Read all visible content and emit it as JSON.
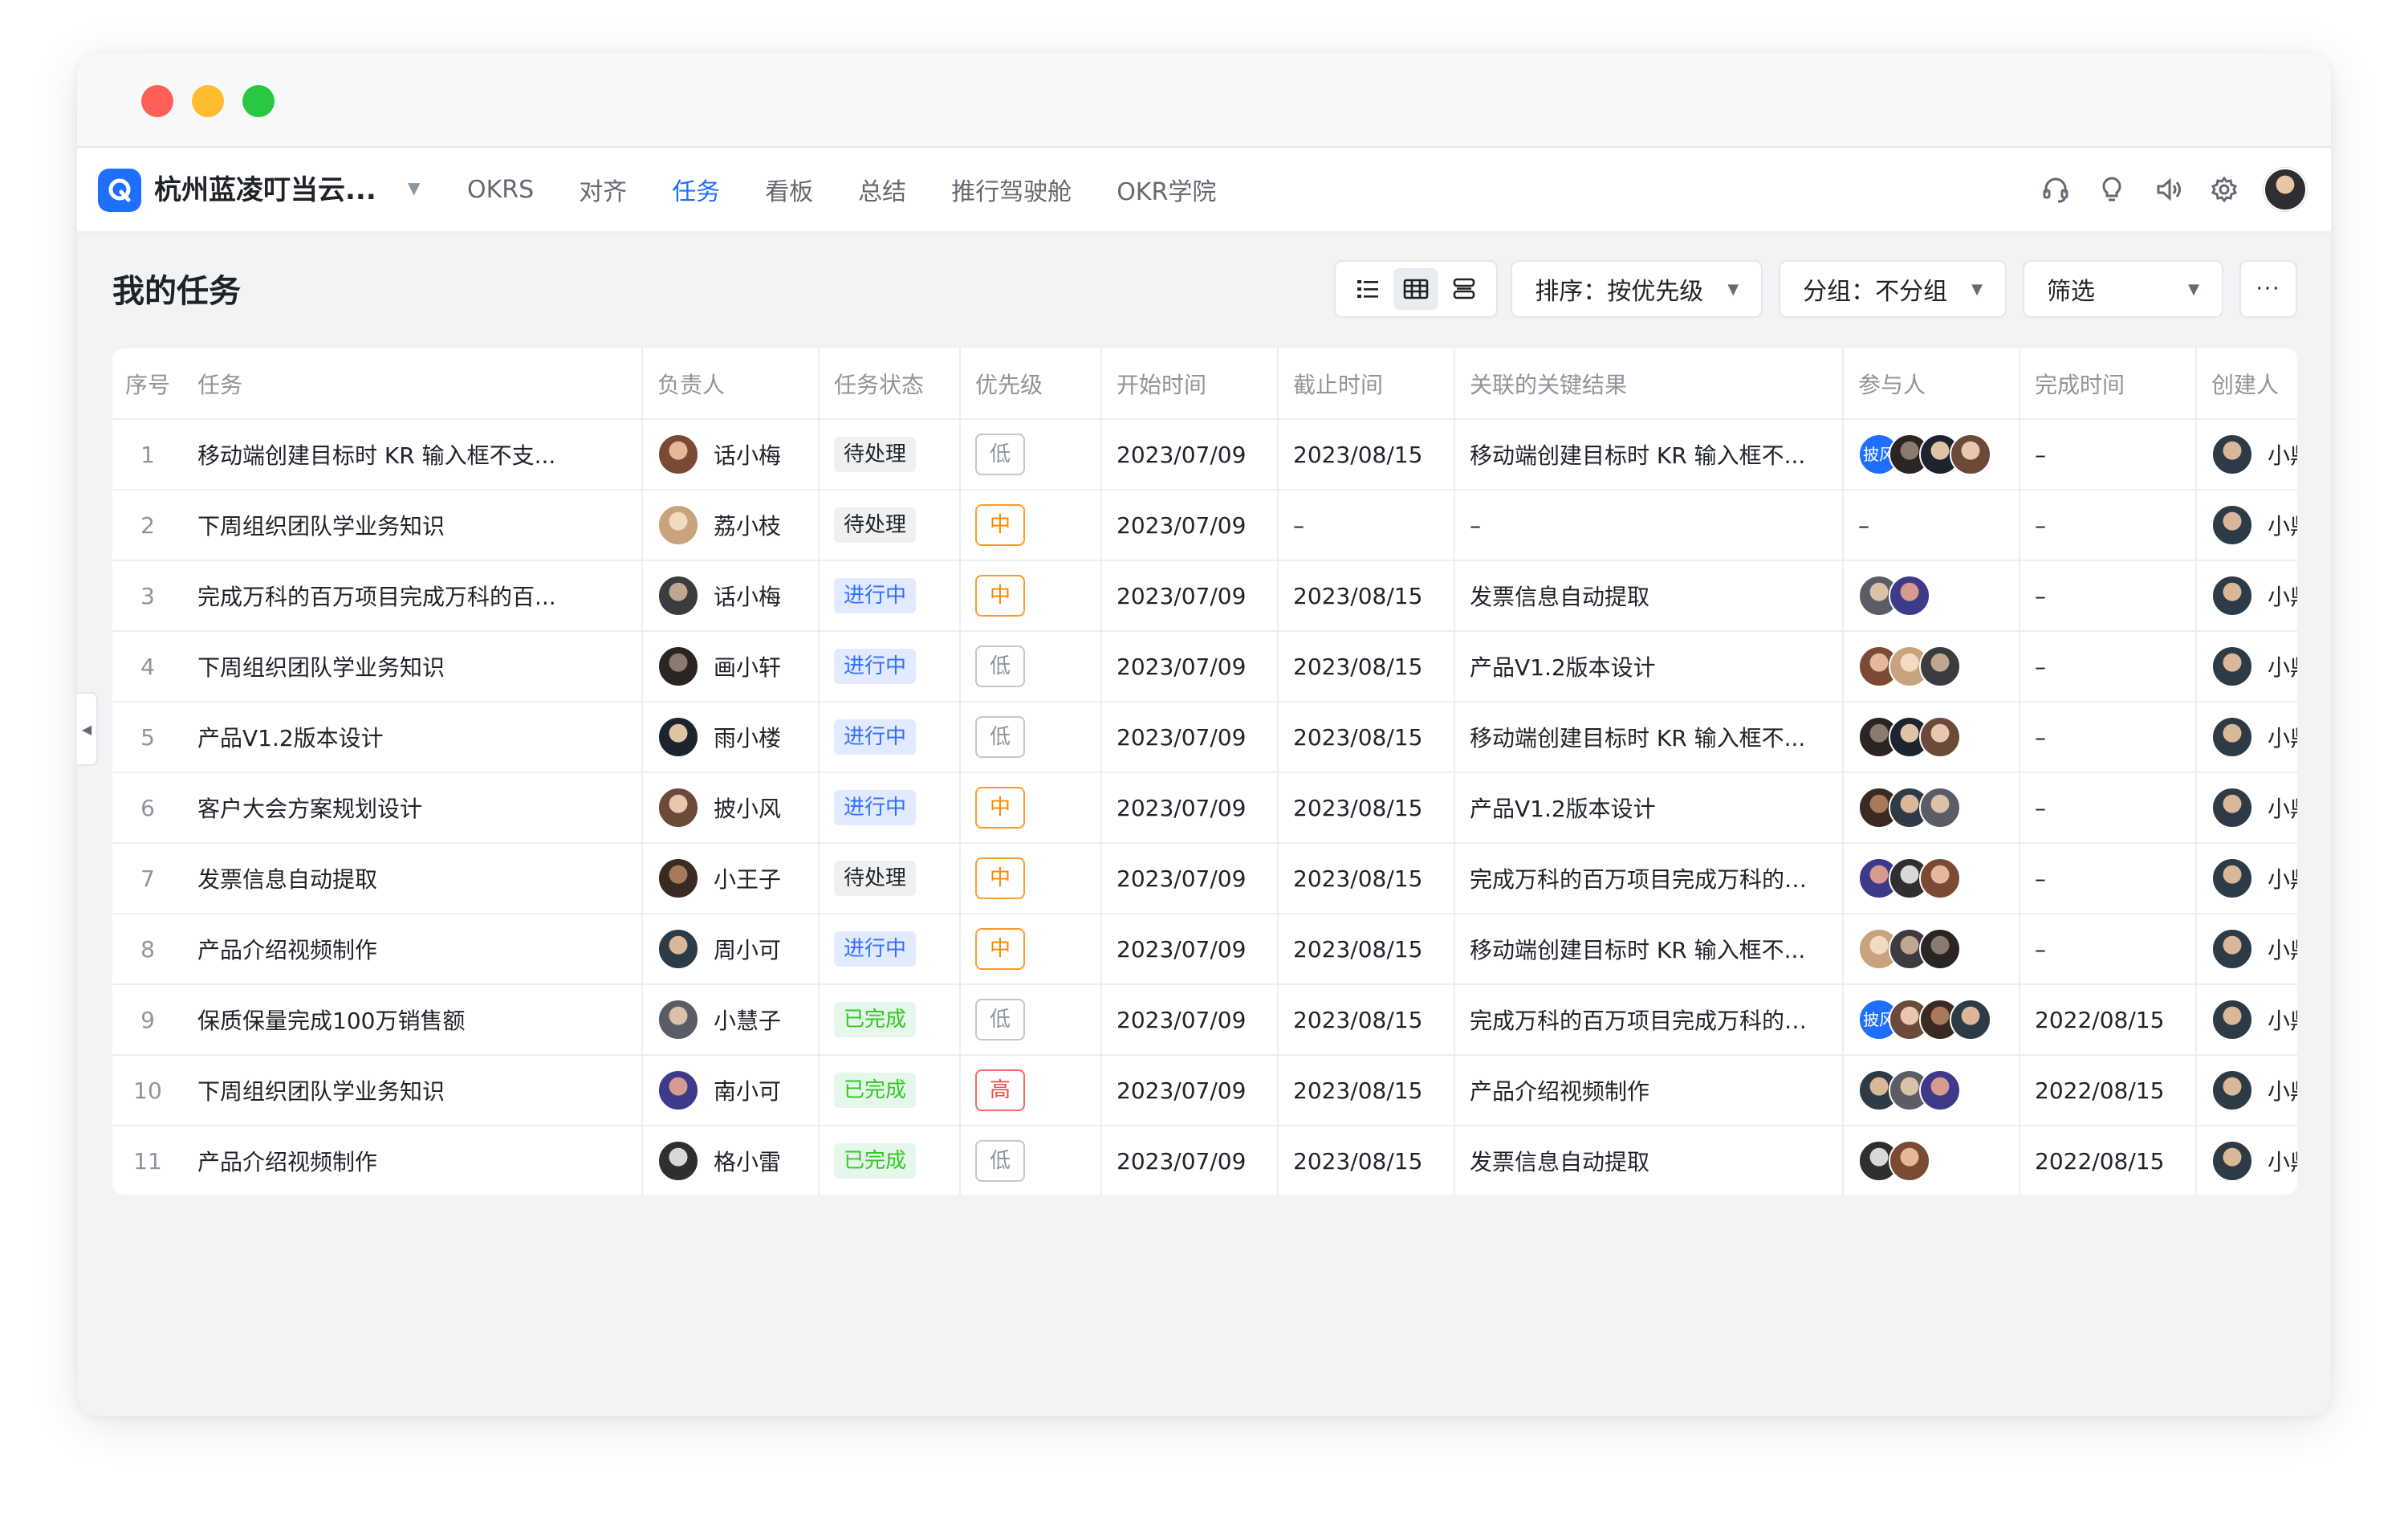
{
  "window": {
    "controls": [
      "close",
      "minimize",
      "maximize"
    ]
  },
  "nav": {
    "company": "杭州蓝凌叮当云...",
    "items": [
      {
        "label": "OKRS",
        "active": false
      },
      {
        "label": "对齐",
        "active": false
      },
      {
        "label": "任务",
        "active": true
      },
      {
        "label": "看板",
        "active": false
      },
      {
        "label": "总结",
        "active": false
      },
      {
        "label": "推行驾驶舱",
        "active": false
      },
      {
        "label": "OKR学院",
        "active": false
      }
    ],
    "icons": [
      "headset-icon",
      "lightbulb-icon",
      "speaker-icon",
      "settings-icon"
    ]
  },
  "page": {
    "title": "我的任务",
    "sort_label": "排序：按优先级",
    "group_label": "分组：不分组",
    "filter_label": "筛选",
    "more_label": "···"
  },
  "colors": {
    "accent": "#1f6fff",
    "in_progress": "#3370ff",
    "done": "#34c724",
    "mid_priority": "#ff8800",
    "high_priority": "#f54a45"
  },
  "table": {
    "headers": [
      "序号",
      "任务",
      "负责人",
      "任务状态",
      "优先级",
      "开始时间",
      "截止时间",
      "关联的关键结果",
      "参与人",
      "完成时间",
      "创建人"
    ],
    "rows": [
      {
        "no": "1",
        "task": "移动端创建目标时 KR 输入框不支...",
        "owner": "话小梅",
        "status": "待处理",
        "priority": "低",
        "start": "2023/07/09",
        "due": "2023/08/15",
        "kr": "移动端创建目标时 KR 输入框不...",
        "participants": [
          "披风",
          "p",
          "p",
          "p"
        ],
        "done": "–",
        "creator": "小鼎"
      },
      {
        "no": "2",
        "task": "下周组织团队学业务知识",
        "owner": "荔小枝",
        "status": "待处理",
        "priority": "中",
        "start": "2023/07/09",
        "due": "–",
        "kr": "–",
        "participants": [],
        "participants_text": "–",
        "done": "–",
        "creator": "小鼎"
      },
      {
        "no": "3",
        "task": "完成万科的百万项目完成万科的百...",
        "owner": "话小梅",
        "status": "进行中",
        "priority": "中",
        "start": "2023/07/09",
        "due": "2023/08/15",
        "kr": "发票信息自动提取",
        "participants": [
          "p",
          "p"
        ],
        "done": "–",
        "creator": "小鼎"
      },
      {
        "no": "4",
        "task": "下周组织团队学业务知识",
        "owner": "画小轩",
        "status": "进行中",
        "priority": "低",
        "start": "2023/07/09",
        "due": "2023/08/15",
        "kr": "产品V1.2版本设计",
        "participants": [
          "p",
          "p",
          "p"
        ],
        "done": "–",
        "creator": "小鼎"
      },
      {
        "no": "5",
        "task": "产品V1.2版本设计",
        "owner": "雨小楼",
        "status": "进行中",
        "priority": "低",
        "start": "2023/07/09",
        "due": "2023/08/15",
        "kr": "移动端创建目标时 KR 输入框不...",
        "participants": [
          "p",
          "p",
          "p"
        ],
        "done": "–",
        "creator": "小鼎"
      },
      {
        "no": "6",
        "task": "客户大会方案规划设计",
        "owner": "披小风",
        "status": "进行中",
        "priority": "中",
        "start": "2023/07/09",
        "due": "2023/08/15",
        "kr": "产品V1.2版本设计",
        "participants": [
          "p",
          "p",
          "p"
        ],
        "done": "–",
        "creator": "小鼎"
      },
      {
        "no": "7",
        "task": "发票信息自动提取",
        "owner": "小王子",
        "status": "待处理",
        "priority": "中",
        "start": "2023/07/09",
        "due": "2023/08/15",
        "kr": "完成万科的百万项目完成万科的百...",
        "participants": [
          "p",
          "p",
          "p"
        ],
        "done": "–",
        "creator": "小鼎"
      },
      {
        "no": "8",
        "task": "产品介绍视频制作",
        "owner": "周小可",
        "status": "进行中",
        "priority": "中",
        "start": "2023/07/09",
        "due": "2023/08/15",
        "kr": "移动端创建目标时 KR 输入框不...",
        "participants": [
          "p",
          "p",
          "p"
        ],
        "done": "–",
        "creator": "小鼎"
      },
      {
        "no": "9",
        "task": "保质保量完成100万销售额",
        "owner": "小慧子",
        "status": "已完成",
        "priority": "低",
        "start": "2023/07/09",
        "due": "2023/08/15",
        "kr": "完成万科的百万项目完成万科的百...",
        "participants": [
          "披风",
          "p",
          "p",
          "p"
        ],
        "done": "2022/08/15",
        "creator": "小鼎"
      },
      {
        "no": "10",
        "task": "下周组织团队学业务知识",
        "owner": "南小可",
        "status": "已完成",
        "priority": "高",
        "start": "2023/07/09",
        "due": "2023/08/15",
        "kr": "产品介绍视频制作",
        "participants": [
          "p",
          "p",
          "p"
        ],
        "done": "2022/08/15",
        "creator": "小鼎"
      },
      {
        "no": "11",
        "task": "产品介绍视频制作",
        "owner": "格小雷",
        "status": "已完成",
        "priority": "低",
        "start": "2023/07/09",
        "due": "2023/08/15",
        "kr": "发票信息自动提取",
        "participants": [
          "p",
          "p"
        ],
        "done": "2022/08/15",
        "creator": "小鼎"
      }
    ]
  }
}
